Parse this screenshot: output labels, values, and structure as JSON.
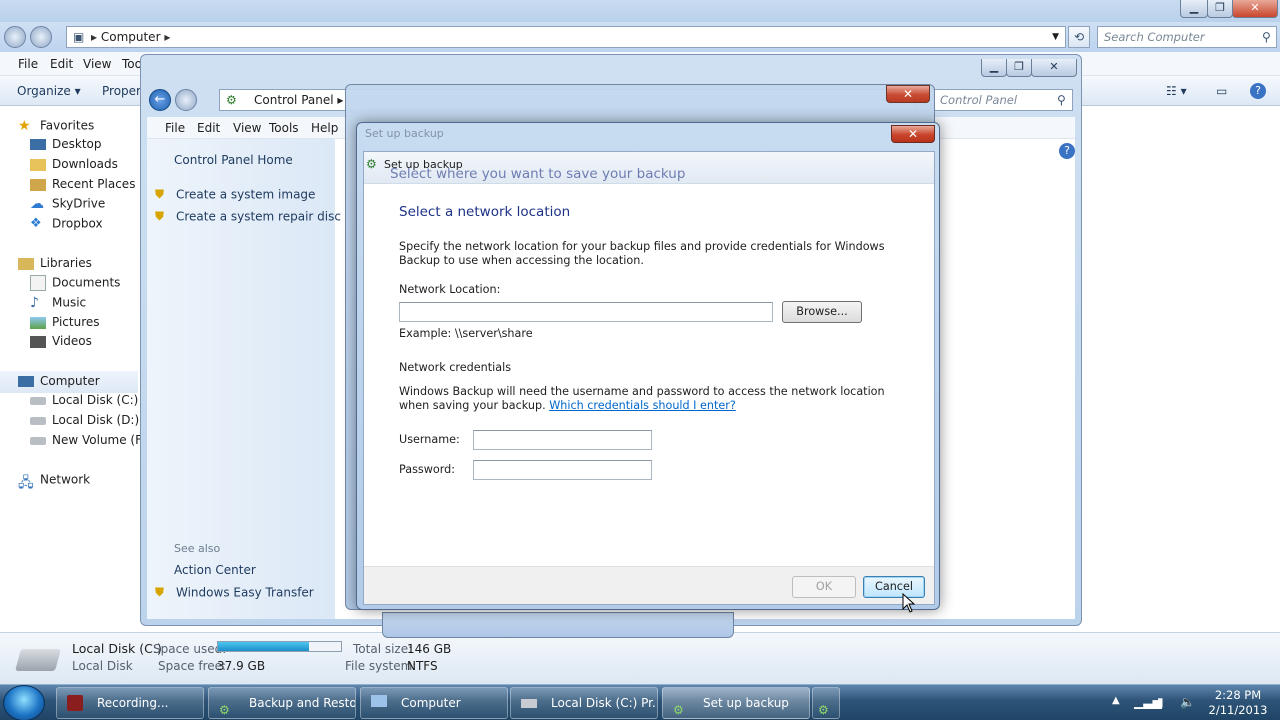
{
  "explorer": {
    "breadcrumb": "Computer",
    "search_placeholder": "Search Computer",
    "menu": [
      "File",
      "Edit",
      "View",
      "Too"
    ],
    "toolbar": {
      "organize": "Organize",
      "properties": "Propert"
    },
    "nav": {
      "favorites": "Favorites",
      "favorites_items": [
        "Desktop",
        "Downloads",
        "Recent Places",
        "SkyDrive",
        "Dropbox"
      ],
      "libraries": "Libraries",
      "libraries_items": [
        "Documents",
        "Music",
        "Pictures",
        "Videos"
      ],
      "computer": "Computer",
      "computer_items": [
        "Local Disk (C:)",
        "Local Disk (D:)",
        "New Volume (F:)"
      ],
      "network": "Network"
    },
    "details": {
      "drive_name": "Local Disk (C:)",
      "drive_type": "Local Disk",
      "space_used_label": "Space used:",
      "space_used_fraction": 0.74,
      "space_free_label": "Space free:",
      "space_free_value": "37.9 GB",
      "total_size_label": "Total size:",
      "total_size_value": "146 GB",
      "file_system_label": "File system:",
      "file_system_value": "NTFS"
    }
  },
  "control_panel": {
    "breadcrumb": "Control Panel",
    "search_placeholder": "Control Panel",
    "menu": [
      "File",
      "Edit",
      "View",
      "Tools",
      "Help"
    ],
    "sidebar": {
      "home": "Control Panel Home",
      "tasks": [
        "Create a system image",
        "Create a system repair disc"
      ],
      "see_also": "See also",
      "see_also_items": [
        "Action Center",
        "Windows Easy Transfer"
      ]
    }
  },
  "dialog": {
    "title": "Set up backup",
    "ghost_title": "Set up backup",
    "bg_heading": "Select where you want to save your backup",
    "heading": "Select a network location",
    "description": "Specify the network location for your backup files and provide credentials for Windows Backup to use when accessing the location.",
    "network_location_label": "Network Location:",
    "network_location_value": "",
    "browse_label": "Browse...",
    "example": "Example: \\\\server\\share",
    "credentials_heading": "Network credentials",
    "credentials_text": "Windows Backup will need the username and password to access the network location when saving your backup.",
    "credentials_link": "Which credentials should I enter?",
    "username_label": "Username:",
    "username_value": "",
    "password_label": "Password:",
    "password_value": "",
    "ok_label": "OK",
    "cancel_label": "Cancel"
  },
  "taskbar": {
    "buttons": [
      "Recording...",
      "Backup and Restore",
      "Computer",
      "Local Disk (C:) Pr...",
      "Set up backup"
    ],
    "clock_time": "2:28 PM",
    "clock_date": "2/11/2013"
  }
}
